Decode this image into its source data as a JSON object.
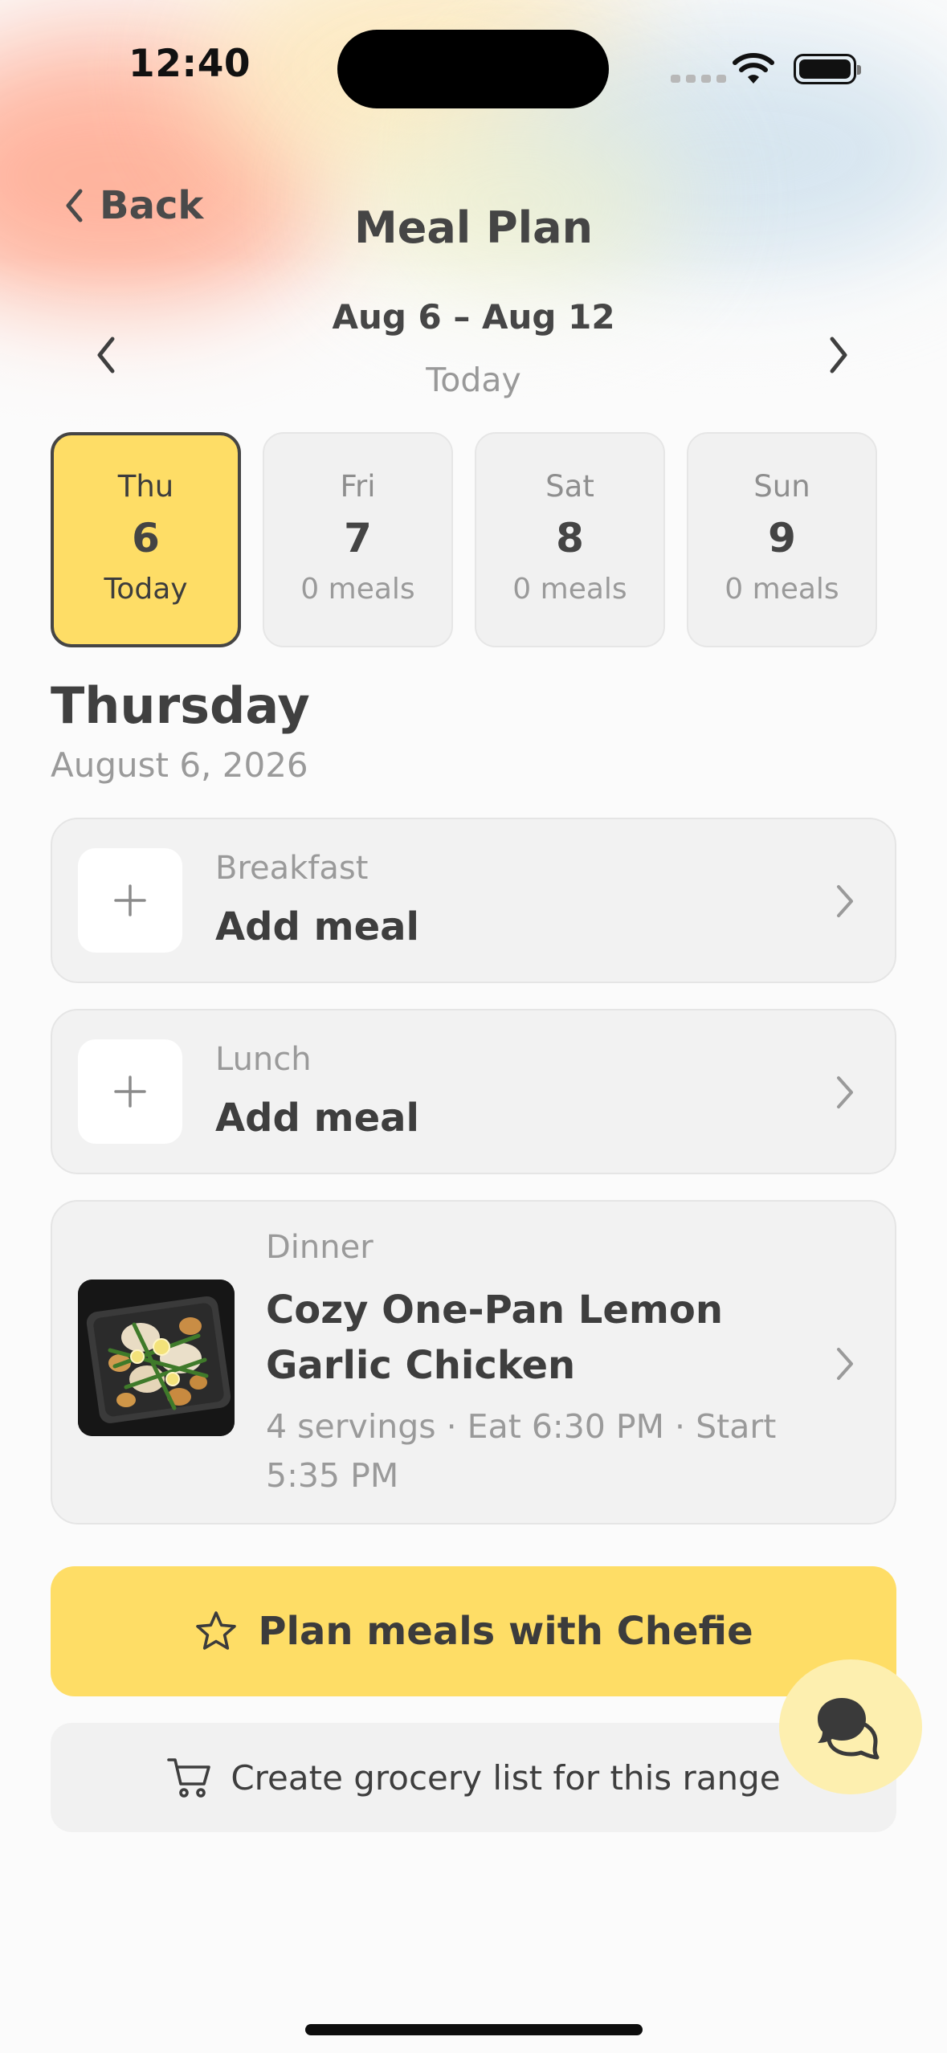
{
  "status_bar": {
    "time": "12:40"
  },
  "nav": {
    "back_label": "Back",
    "title": "Meal Plan"
  },
  "week": {
    "range_label": "Aug 6 – Aug 12",
    "today_label": "Today"
  },
  "days": [
    {
      "name": "Thu",
      "number": "6",
      "sub": "Today",
      "selected": true
    },
    {
      "name": "Fri",
      "number": "7",
      "sub": "0 meals",
      "selected": false
    },
    {
      "name": "Sat",
      "number": "8",
      "sub": "0 meals",
      "selected": false
    },
    {
      "name": "Sun",
      "number": "9",
      "sub": "0 meals",
      "selected": false
    }
  ],
  "selected_day": {
    "weekday": "Thursday",
    "date": "August 6, 2026"
  },
  "meals": {
    "breakfast": {
      "type": "Breakfast",
      "action": "Add meal"
    },
    "lunch": {
      "type": "Lunch",
      "action": "Add meal"
    },
    "dinner": {
      "type": "Dinner",
      "title": "Cozy One-Pan Lemon Garlic Chicken",
      "meta": "4 servings · Eat 6:30 PM · Start 5:35 PM"
    }
  },
  "actions": {
    "plan_label": "Plan meals with Chefie",
    "grocery_label": "Create grocery list for this range"
  },
  "colors": {
    "accent": "#fedd66",
    "fab": "#fdefaf",
    "card": "#f2f2f2"
  },
  "icons": [
    "chevron-left-icon",
    "chevron-right-icon",
    "plus-icon",
    "star-icon",
    "cart-icon",
    "chat-bubbles-icon"
  ]
}
